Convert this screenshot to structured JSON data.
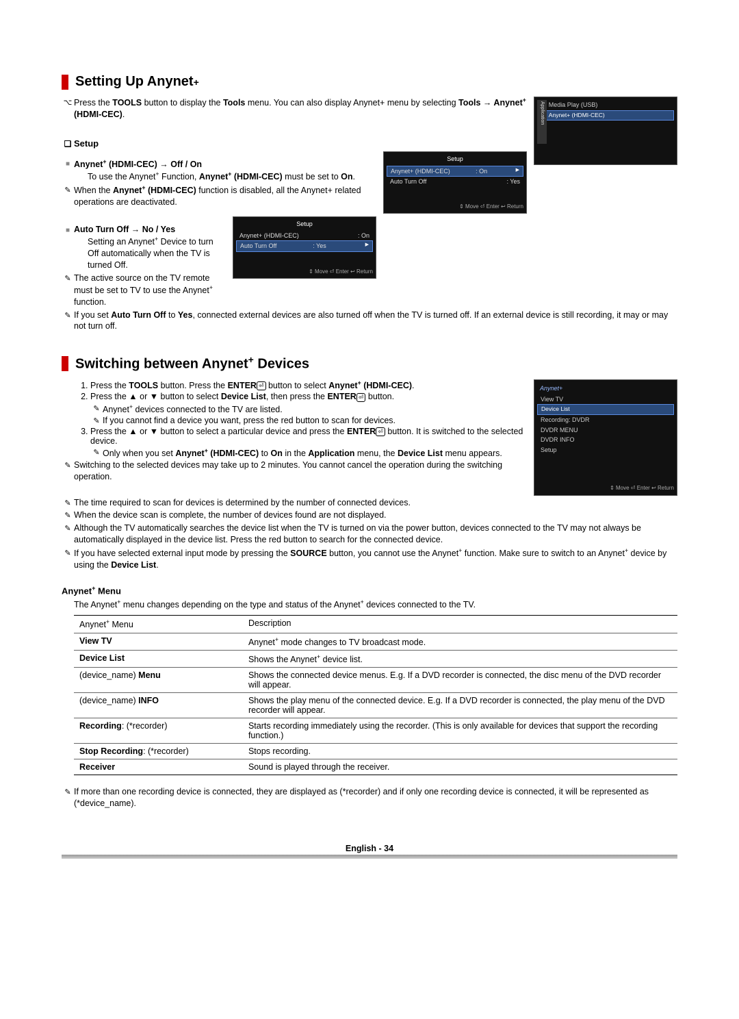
{
  "section1": {
    "title": "Setting Up Anynet",
    "titleSup": "+",
    "intro": "Press the TOOLS button to display the Tools menu. You can also display Anynet+ menu by selecting Tools → Anynet+ (HDMI-CEC).",
    "setup": {
      "heading": "Setup",
      "item1": {
        "head": "Anynet+ (HDMI-CEC) → Off / On",
        "line1": "To use the Anynet+ Function, Anynet+ (HDMI-CEC) must be set to On.",
        "note1": "When the Anynet+ (HDMI-CEC) function is disabled, all the Anynet+ related operations are deactivated."
      },
      "item2": {
        "head": "Auto Turn Off → No / Yes",
        "line1": "Setting an Anynet+ Device to turn Off automatically when the TV is turned Off.",
        "note1": "The active source on the TV remote must be set to TV to use the Anynet+ function.",
        "note2": "If you set Auto Turn Off to Yes, connected external devices are also turned off when the TV is turned off. If an external device is still recording, it may or may not turn off."
      }
    }
  },
  "section2": {
    "title": "Switching between Anynet",
    "titleSup": "+",
    "titleTail": " Devices",
    "steps": {
      "s1": "Press the TOOLS button. Press the ENTER button to select Anynet+ (HDMI-CEC).",
      "s2": "Press the ▲ or ▼ button to select Device List, then press the ENTER button.",
      "s2n1": "Anynet+ devices connected to the TV are listed.",
      "s2n2": "If you cannot find a device you want, press the red button to scan for devices.",
      "s3": "Press the ▲ or ▼ button to select a particular device and press the ENTER button. It is switched to the selected device.",
      "s3n1": "Only when you set Anynet+ (HDMI-CEC) to On in the Application menu, the Device List menu appears."
    },
    "notes": {
      "n1": "Switching to the selected devices may take up to 2 minutes. You cannot cancel the operation during the switching operation.",
      "n2": "The time required to scan for devices is determined by the number of connected devices.",
      "n3": "When the device scan is complete, the number of devices found are not displayed.",
      "n4": "Although the TV automatically searches the device list when the TV is turned on via the power button, devices connected to the TV may not always be automatically displayed in the device list. Press the red button to search for the connected device.",
      "n5": "If you have selected external input mode by pressing the SOURCE button, you cannot use the Anynet+ function. Make sure to switch to an Anynet+ device by using the Device List."
    }
  },
  "anynetMenu": {
    "heading": "Anynet+ Menu",
    "intro": "The Anynet+ menu changes depending on the type and status of the Anynet+ devices connected to the TV.",
    "colMenu": "Anynet+ Menu",
    "colDesc": "Description",
    "rows": {
      "r1m": "View TV",
      "r1d": "Anynet+ mode changes to TV broadcast mode.",
      "r2m": "Device List",
      "r2d": "Shows the Anynet+ device list.",
      "r3m": "(device_name) Menu",
      "r3d": "Shows the connected device menus. E.g. If a DVD recorder is connected, the disc menu of the DVD recorder will appear.",
      "r4m": "(device_name) INFO",
      "r4d": "Shows the play menu of the connected device. E.g. If a DVD recorder is connected, the play menu of the DVD recorder will appear.",
      "r5m": "Recording: (*recorder)",
      "r5d": "Starts recording immediately using the recorder. (This is only available for devices that support the recording function.)",
      "r6m": "Stop Recording: (*recorder)",
      "r6d": "Stops recording.",
      "r7m": "Receiver",
      "r7d": "Sound is played through the receiver."
    },
    "footnote": "If more than one recording device is connected, they are displayed as (*recorder) and if only one recording device is connected, it will be represented as (*device_name)."
  },
  "osd": {
    "app": {
      "sidebar": "Application",
      "item1": "Media Play (USB)",
      "item2": "Anynet+ (HDMI-CEC)"
    },
    "setup": {
      "title": "Setup",
      "k1": "Anynet+ (HDMI-CEC)",
      "v1": ": On",
      "k2": "Auto Turn Off",
      "v2": ": Yes",
      "footer": "⇕ Move   ⏎ Enter   ↩ Return"
    },
    "anynet": {
      "title": "Anynet+",
      "i1": "View TV",
      "i2": "Device List",
      "i3": "Recording: DVDR",
      "i4": "DVDR MENU",
      "i5": "DVDR INFO",
      "i6": "Setup",
      "footer": "⇕ Move   ⏎ Enter   ↩ Return"
    }
  },
  "footer": {
    "text": "English - 34"
  }
}
